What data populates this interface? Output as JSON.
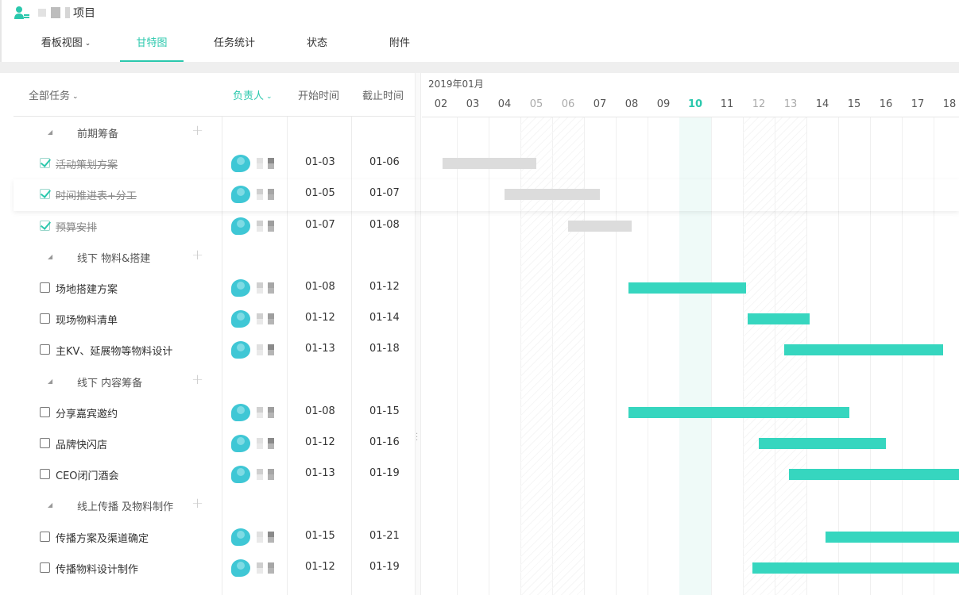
{
  "project": {
    "title": "项目"
  },
  "tabs": [
    {
      "label": "看板视图",
      "dropdown": true
    },
    {
      "label": "甘特图",
      "active": true
    },
    {
      "label": "任务统计"
    },
    {
      "label": "状态"
    },
    {
      "label": "附件"
    }
  ],
  "columns": {
    "filter_label": "全部任务",
    "assignee": "负责人",
    "start": "开始时间",
    "end": "截止时间"
  },
  "gantt": {
    "month": "2019年01月",
    "days": [
      "02",
      "03",
      "04",
      "05",
      "06",
      "07",
      "08",
      "09",
      "10",
      "11",
      "12",
      "13",
      "14",
      "15",
      "16",
      "17",
      "18"
    ],
    "weekend_days": [
      "05",
      "06",
      "12",
      "13"
    ],
    "today": "10"
  },
  "colors": {
    "accent": "#2bc8ad",
    "bar_open": "#36d6bf",
    "bar_done": "#dcdcdc"
  },
  "groups": [
    {
      "name": "前期筹备",
      "tasks": [
        {
          "name": "活动策划方案",
          "done": true,
          "start": "01-03",
          "end": "01-06",
          "bar_start_day": 2.55,
          "bar_end_day": 5.5
        },
        {
          "name": "时间推进表+分工",
          "done": true,
          "start": "01-05",
          "end": "01-07",
          "bar_start_day": 4.5,
          "bar_end_day": 7.5
        },
        {
          "name": "预算安排",
          "done": true,
          "start": "01-07",
          "end": "01-08",
          "bar_start_day": 6.5,
          "bar_end_day": 8.5
        }
      ]
    },
    {
      "name": "线下 物料&搭建",
      "tasks": [
        {
          "name": "场地搭建方案",
          "done": false,
          "start": "01-08",
          "end": "01-12",
          "bar_start_day": 8.4,
          "bar_end_day": 12.1
        },
        {
          "name": "现场物料清单",
          "done": false,
          "start": "01-12",
          "end": "01-14",
          "bar_start_day": 12.15,
          "bar_end_day": 14.1
        },
        {
          "name": "主KV、延展物等物料设计",
          "done": false,
          "start": "01-13",
          "end": "01-18",
          "bar_start_day": 13.3,
          "bar_end_day": 18.3
        }
      ]
    },
    {
      "name": "线下 内容筹备",
      "tasks": [
        {
          "name": "分享嘉宾邀约",
          "done": false,
          "start": "01-08",
          "end": "01-15",
          "bar_start_day": 8.4,
          "bar_end_day": 15.35
        },
        {
          "name": "品牌快闪店",
          "done": false,
          "start": "01-12",
          "end": "01-16",
          "bar_start_day": 12.5,
          "bar_end_day": 16.5
        },
        {
          "name": "CEO闭门酒会",
          "done": false,
          "start": "01-13",
          "end": "01-19",
          "bar_start_day": 13.45,
          "bar_end_day": 19
        }
      ]
    },
    {
      "name": "线上传播 及物料制作",
      "tasks": [
        {
          "name": "传播方案及渠道确定",
          "done": false,
          "start": "01-15",
          "end": "01-21",
          "bar_start_day": 14.6,
          "bar_end_day": 19
        },
        {
          "name": "传播物料设计制作",
          "done": false,
          "start": "01-12",
          "end": "01-19",
          "bar_start_day": 12.3,
          "bar_end_day": 19
        }
      ]
    }
  ]
}
